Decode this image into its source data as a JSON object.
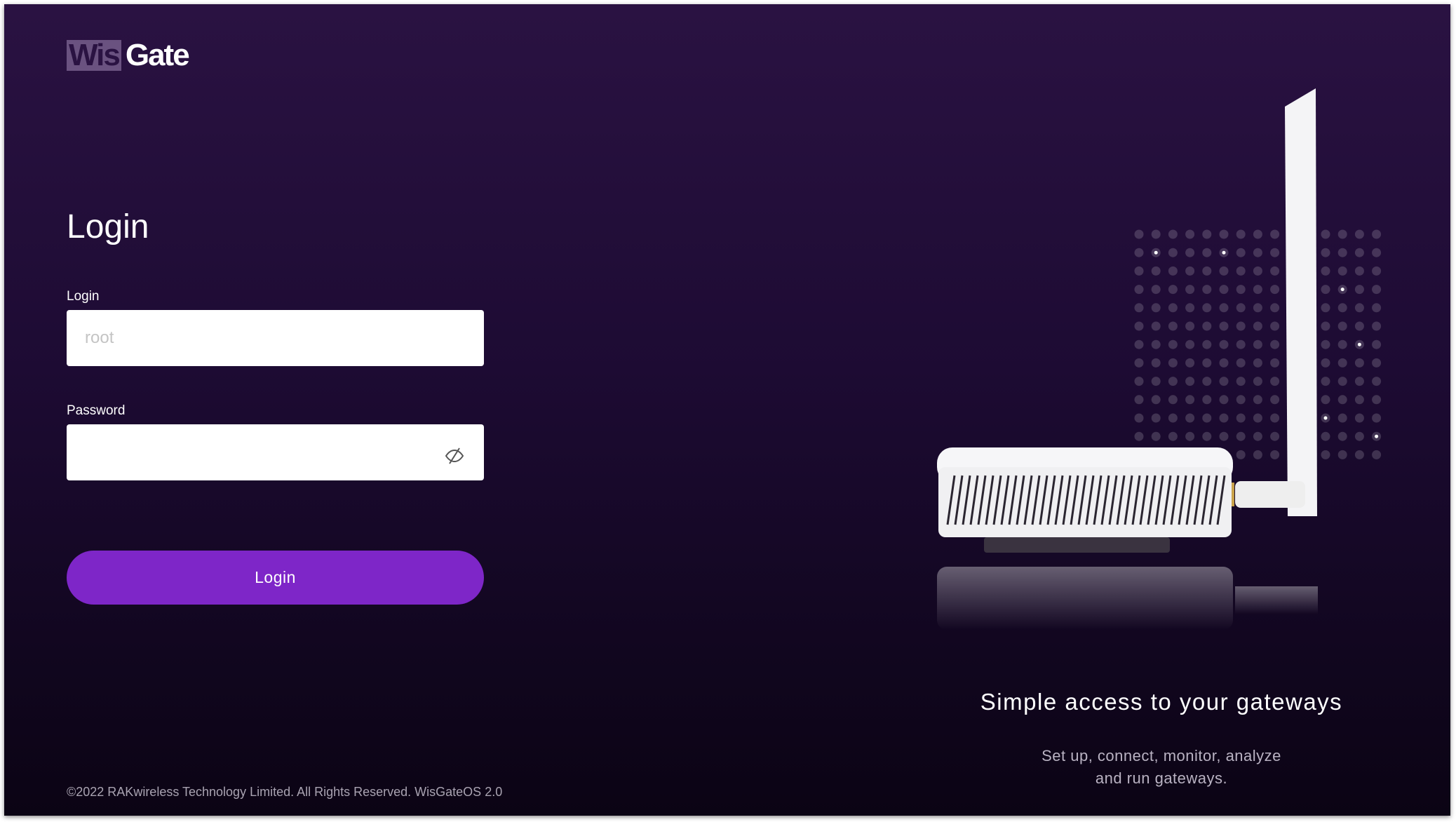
{
  "logo": {
    "part1": "Wis",
    "part2": "Gate"
  },
  "form": {
    "title": "Login",
    "login_label": "Login",
    "login_placeholder": "root",
    "login_value": "",
    "password_label": "Password",
    "password_value": "",
    "submit_label": "Login"
  },
  "hero": {
    "tagline": "Simple access to your gateways",
    "description_line1": "Set up, connect, monitor, analyze",
    "description_line2": "and run gateways."
  },
  "footer": {
    "copyright": "©2022 RAKwireless Technology Limited. All Rights Reserved. WisGateOS 2.0"
  },
  "colors": {
    "accent": "#7e26c8",
    "background": "#1d0b33"
  }
}
